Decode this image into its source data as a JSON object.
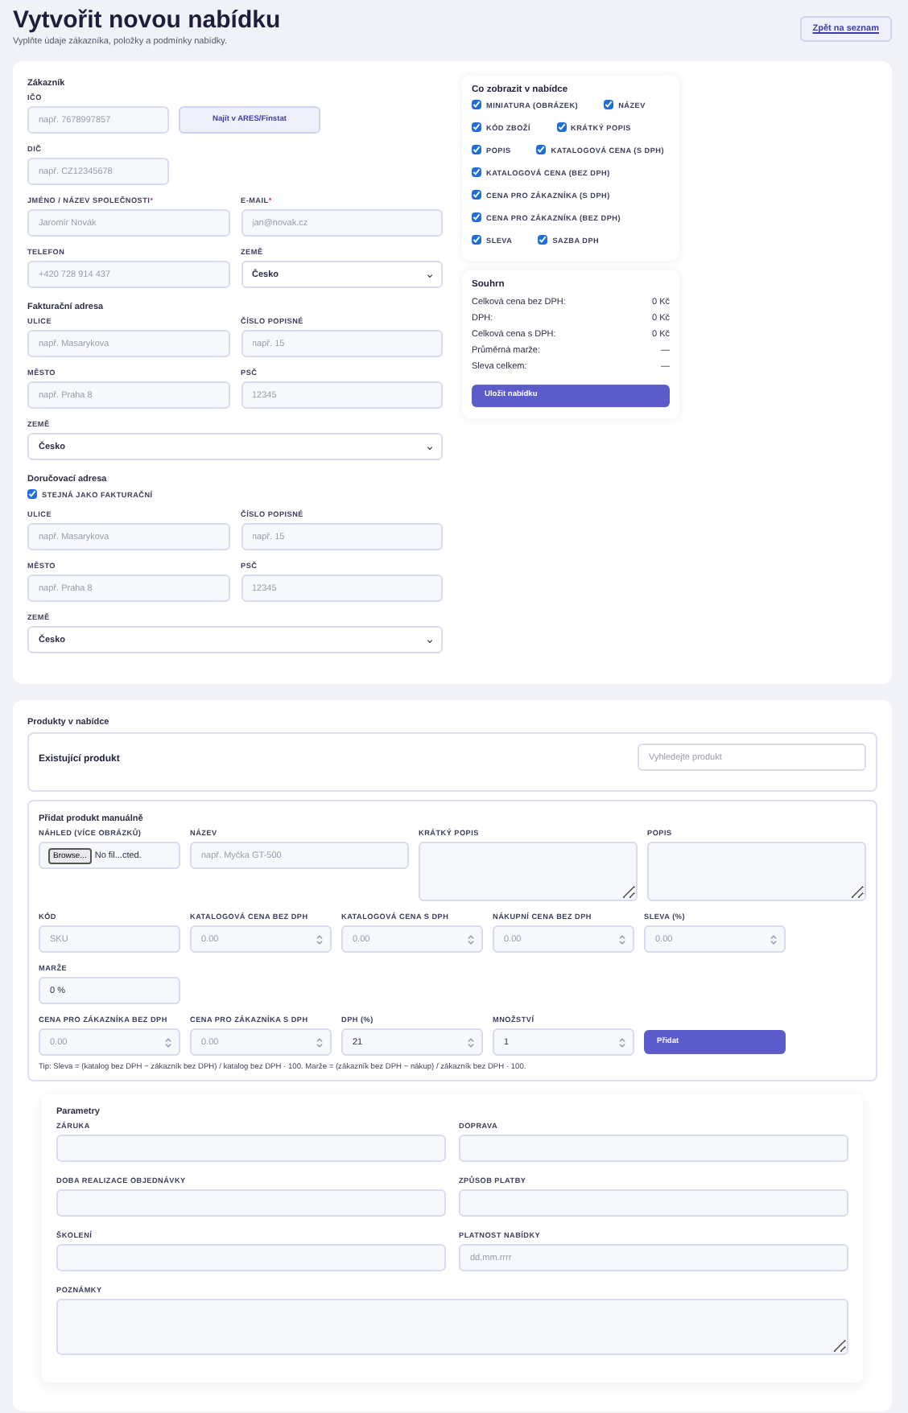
{
  "page": {
    "title": "Vytvořit novou nabídku",
    "subtitle": "Vyplňte údaje zákazníka, položky a podmínky nabídky.",
    "back_link": "Zpět na seznam"
  },
  "customer": {
    "sections": [
      {
        "heading": "Zákazník",
        "rows": [
          {
            "kind": "short",
            "fields": [
              {
                "kind": "text",
                "label": "IČO",
                "placeholder": "např. 7678997857"
              },
              {
                "kind": "button",
                "label": "Najít v ARES/Finstat"
              }
            ]
          },
          {
            "kind": "short",
            "fields": [
              {
                "kind": "text",
                "label": "DIČ",
                "placeholder": "např. CZ12345678"
              }
            ]
          },
          {
            "kind": "halves",
            "fields": [
              {
                "kind": "text",
                "label": "JMÉNO / NÁZEV SPOLEČNOSTI",
                "required_mark": "*",
                "placeholder": "Jaromír Novák"
              },
              {
                "kind": "text",
                "label": "E-MAIL",
                "required_mark": "*",
                "placeholder": "jan@novak.cz"
              }
            ]
          },
          {
            "kind": "halves",
            "fields": [
              {
                "kind": "text",
                "label": "TELEFON",
                "placeholder": "+420 728 914 437"
              },
              {
                "kind": "select",
                "label": "ZEMĚ",
                "value": "Česko"
              }
            ]
          }
        ]
      },
      {
        "heading": "Fakturační adresa",
        "rows": [
          {
            "kind": "halves",
            "fields": [
              {
                "kind": "text",
                "label": "ULICE",
                "placeholder": "např. Masarykova"
              },
              {
                "kind": "text",
                "label": "ČÍSLO POPISNÉ",
                "placeholder": "např. 15"
              }
            ]
          },
          {
            "kind": "halves",
            "fields": [
              {
                "kind": "text",
                "label": "MĚSTO",
                "placeholder": "např. Praha 8"
              },
              {
                "kind": "text",
                "label": "PSČ",
                "placeholder": "12345"
              }
            ]
          },
          {
            "kind": "full",
            "fields": [
              {
                "kind": "select",
                "label": "ZEMĚ",
                "value": "Česko"
              }
            ]
          }
        ]
      },
      {
        "heading": "Doručovací adresa",
        "rows": [
          {
            "kind": "full",
            "fields": [
              {
                "kind": "checkbox",
                "label": "STEJNÁ JAKO FAKTURAČNÍ",
                "checked": true
              }
            ]
          },
          {
            "kind": "halves",
            "fields": [
              {
                "kind": "text",
                "label": "ULICE",
                "placeholder": "např. Masarykova"
              },
              {
                "kind": "text",
                "label": "ČÍSLO POPISNÉ",
                "placeholder": "např. 15"
              }
            ]
          },
          {
            "kind": "halves",
            "fields": [
              {
                "kind": "text",
                "label": "MĚSTO",
                "placeholder": "např. Praha 8"
              },
              {
                "kind": "text",
                "label": "PSČ",
                "placeholder": "12345"
              }
            ]
          },
          {
            "kind": "full",
            "fields": [
              {
                "kind": "select",
                "label": "ZEMĚ",
                "value": "Česko"
              }
            ]
          }
        ]
      }
    ]
  },
  "display_options": {
    "title": "Co zobrazit v nabídce",
    "items": [
      {
        "label": "MINIATURA (OBRÁZEK)",
        "checked": true
      },
      {
        "label": "NÁZEV",
        "checked": true
      },
      {
        "label": "KÓD ZBOŽÍ",
        "checked": true
      },
      {
        "label": "KRÁTKÝ POPIS",
        "checked": true
      },
      {
        "label": "POPIS",
        "checked": true
      },
      {
        "label": "KATALOGOVÁ CENA (S DPH)",
        "checked": true
      },
      {
        "label": "KATALOGOVÁ CENA (BEZ DPH)",
        "checked": true
      },
      {
        "label": "CENA PRO ZÁKAZNÍKA (S DPH)",
        "checked": true
      },
      {
        "label": "CENA PRO ZÁKAZNÍKA (BEZ DPH)",
        "checked": true
      },
      {
        "label": "SLEVA",
        "checked": true
      },
      {
        "label": "SAZBA DPH",
        "checked": true
      }
    ]
  },
  "summary": {
    "title": "Souhrn",
    "rows": [
      {
        "label": "Celková cena bez DPH:",
        "value": "0 Kč"
      },
      {
        "label": "DPH:",
        "value": "0 Kč"
      },
      {
        "label": "Celková cena s DPH:",
        "value": "0 Kč"
      },
      {
        "label": "Průměrná marže:",
        "value": "—"
      },
      {
        "label": "Sleva celkem:",
        "value": "—"
      }
    ],
    "button": "Uložit nabídku"
  },
  "products": {
    "title": "Produkty v nabídce",
    "existing": {
      "title": "Existující produkt",
      "search": {
        "placeholder": "Vyhledejte produkt"
      }
    },
    "manual": {
      "title": "Přidat produkt manuálně",
      "rows": [
        {
          "kind": "media",
          "fields": [
            {
              "kind": "file",
              "label": "NÁHLED (VÍCE OBRÁZKŮ)",
              "button": "Browse...",
              "value": "No fil...cted."
            },
            {
              "kind": "text",
              "label": "NÁZEV",
              "placeholder": "např. Myčka GT-500"
            },
            {
              "kind": "textarea",
              "label": "KRÁTKÝ POPIS"
            },
            {
              "kind": "textarea",
              "label": "POPIS"
            }
          ]
        },
        {
          "kind": "fifths",
          "fields": [
            {
              "kind": "text",
              "label": "KÓD",
              "placeholder": "SKU"
            },
            {
              "kind": "number",
              "label": "KATALOGOVÁ CENA BEZ DPH",
              "placeholder": "0.00"
            },
            {
              "kind": "number",
              "label": "KATALOGOVÁ CENA S DPH",
              "placeholder": "0.00"
            },
            {
              "kind": "number",
              "label": "NÁKUPNÍ CENA BEZ DPH",
              "placeholder": "0.00"
            },
            {
              "kind": "number",
              "label": "SLEVA (%)",
              "placeholder": "0.00"
            }
          ]
        },
        {
          "kind": "fifths",
          "fields": [
            {
              "kind": "text",
              "label": "MARŽE",
              "value": "0 %"
            }
          ]
        },
        {
          "kind": "fifths",
          "fields": [
            {
              "kind": "number",
              "label": "CENA PRO ZÁKAZNÍKA BEZ DPH",
              "placeholder": "0.00"
            },
            {
              "kind": "number",
              "label": "CENA PRO ZÁKAZNÍKA S DPH",
              "placeholder": "0.00"
            },
            {
              "kind": "number",
              "label": "DPH (%)",
              "value": "21"
            },
            {
              "kind": "number",
              "label": "MNOŽSTVÍ",
              "value": "1"
            },
            {
              "kind": "submit",
              "label": "Přidat"
            }
          ]
        }
      ],
      "tip": "Tip: Sleva = (katalog bez DPH − zákazník bez DPH) / katalog bez DPH · 100. Marže = (zákazník bez DPH − nákup) / zákazník bez DPH · 100."
    },
    "parameters": {
      "title": "Parametry",
      "rows": [
        {
          "kind": "halves",
          "fields": [
            {
              "kind": "text",
              "label": "ZÁRUKA"
            },
            {
              "kind": "text",
              "label": "DOPRAVA"
            }
          ]
        },
        {
          "kind": "halves",
          "fields": [
            {
              "kind": "text",
              "label": "DOBA REALIZACE OBJEDNÁVKY"
            },
            {
              "kind": "text",
              "label": "ZPŮSOB PLATBY"
            }
          ]
        },
        {
          "kind": "halves",
          "fields": [
            {
              "kind": "text",
              "label": "ŠKOLENÍ"
            },
            {
              "kind": "text",
              "label": "PLATNOST NABÍDKY",
              "placeholder": "dd.mm.rrrr"
            }
          ]
        },
        {
          "kind": "full",
          "fields": [
            {
              "kind": "textarea",
              "label": "POZNÁMKY"
            }
          ]
        }
      ]
    }
  }
}
